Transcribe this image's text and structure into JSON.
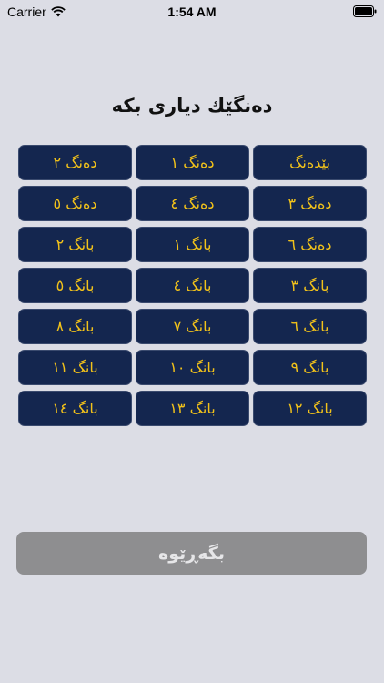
{
  "status_bar": {
    "carrier": "Carrier",
    "time": "1:54 AM"
  },
  "title": "دەنگێك دیاری بکە",
  "buttons": [
    "بێدەنگ",
    "دەنگ ١",
    "دەنگ ٢",
    "دەنگ ٣",
    "دەنگ ٤",
    "دەنگ ٥",
    "دەنگ ٦",
    "بانگ ١",
    "بانگ ٢",
    "بانگ ٣",
    "بانگ ٤",
    "بانگ ٥",
    "بانگ ٦",
    "بانگ ٧",
    "بانگ ٨",
    "بانگ ٩",
    "بانگ ١٠",
    "بانگ ١١",
    "بانگ ١٢",
    "بانگ ١٣",
    "بانگ ١٤"
  ],
  "back_button": "بگەڕێوە",
  "colors": {
    "background": "#dcdde5",
    "button_bg": "#14264f",
    "button_text": "#f2c21a",
    "back_bg": "#8e8e90",
    "back_text": "#e6e6e8"
  },
  "icons": {
    "wifi": "wifi-icon",
    "battery": "battery-icon"
  }
}
